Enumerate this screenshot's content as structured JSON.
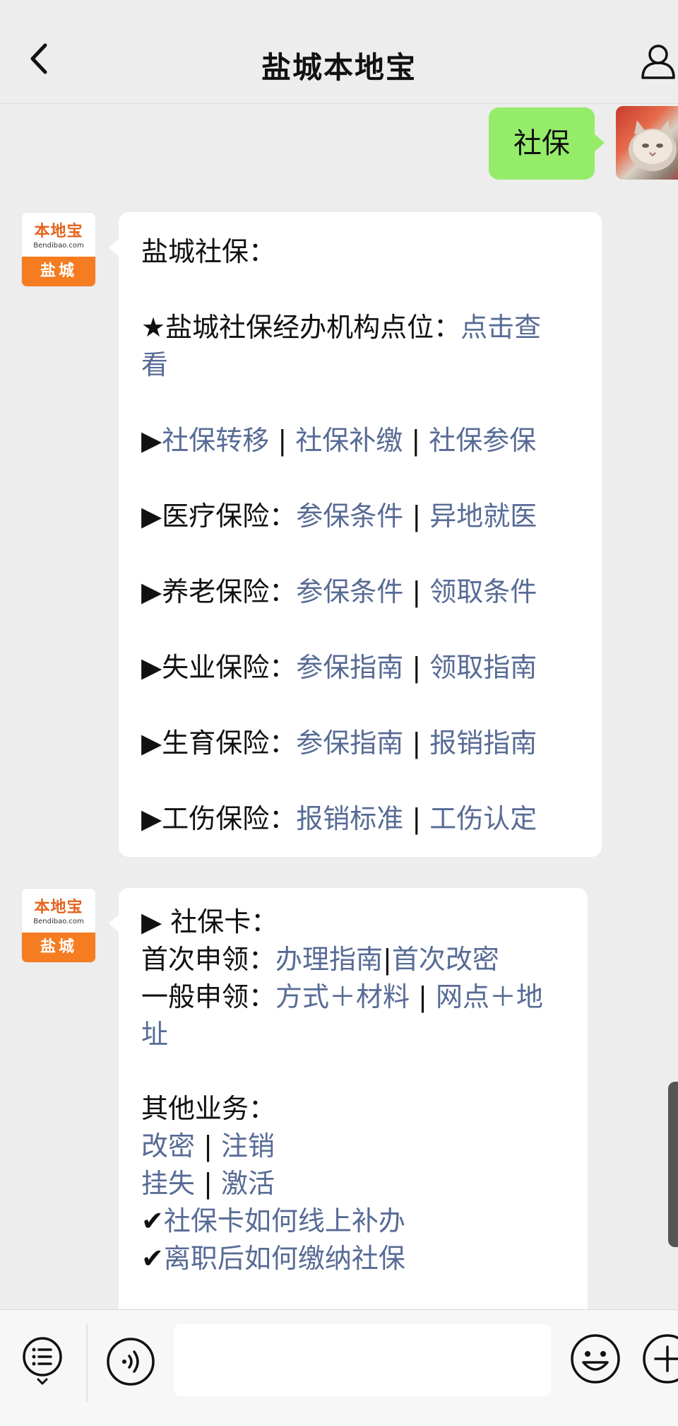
{
  "header": {
    "title": "盐城本地宝"
  },
  "user_message": {
    "text": "社保"
  },
  "bot_avatar": {
    "logo": "本地宝",
    "site": "Bendibao.com",
    "city": "盐城"
  },
  "message1": {
    "heading": "盐城社保：",
    "star_line": {
      "prefix": "★盐城社保经办机构点位：",
      "link_part1": "点击查",
      "link_part2": "看"
    },
    "transfer_line": {
      "arrow": "▶",
      "link1": "社保转移",
      "sep1": " | ",
      "link2": "社保补缴",
      "sep2": " | ",
      "link3": "社保参保"
    },
    "insurance_lines": [
      {
        "label": "▶医疗保险：",
        "link1": "参保条件",
        "sep": " | ",
        "link2": "异地就医"
      },
      {
        "label": "▶养老保险：",
        "link1": "参保条件",
        "sep": " | ",
        "link2": "领取条件"
      },
      {
        "label": "▶失业保险：",
        "link1": "参保指南",
        "sep": " | ",
        "link2": "领取指南"
      },
      {
        "label": "▶生育保险：",
        "link1": "参保指南",
        "sep": " | ",
        "link2": "报销指南"
      },
      {
        "label": "▶工伤保险：",
        "link1": "报销标准",
        "sep": " | ",
        "link2": "工伤认定"
      }
    ]
  },
  "message2": {
    "card_heading": "▶ 社保卡：",
    "first_apply": {
      "label": "首次申领：",
      "link1": "办理指南",
      "sep": "|",
      "link2": "首次改密"
    },
    "general_apply": {
      "label": "一般申领：",
      "link1": "方式＋材料",
      "sep": " | ",
      "link2_part1": "网点＋地",
      "link2_part2": "址"
    },
    "other_heading": "其他业务：",
    "other_row1": {
      "link1": "改密",
      "sep": " | ",
      "link2": "注销"
    },
    "other_row2": {
      "link1": "挂失",
      "sep": " | ",
      "link2": "激活"
    },
    "check_items": [
      {
        "mark": "✔",
        "link": "社保卡如何线上补办"
      },
      {
        "mark": "✔",
        "link": "离职后如何缴纳社保"
      }
    ]
  },
  "icons": [
    "back-arrow-icon",
    "profile-icon",
    "menu-list-icon",
    "voice-icon",
    "emoji-icon",
    "plus-icon"
  ]
}
